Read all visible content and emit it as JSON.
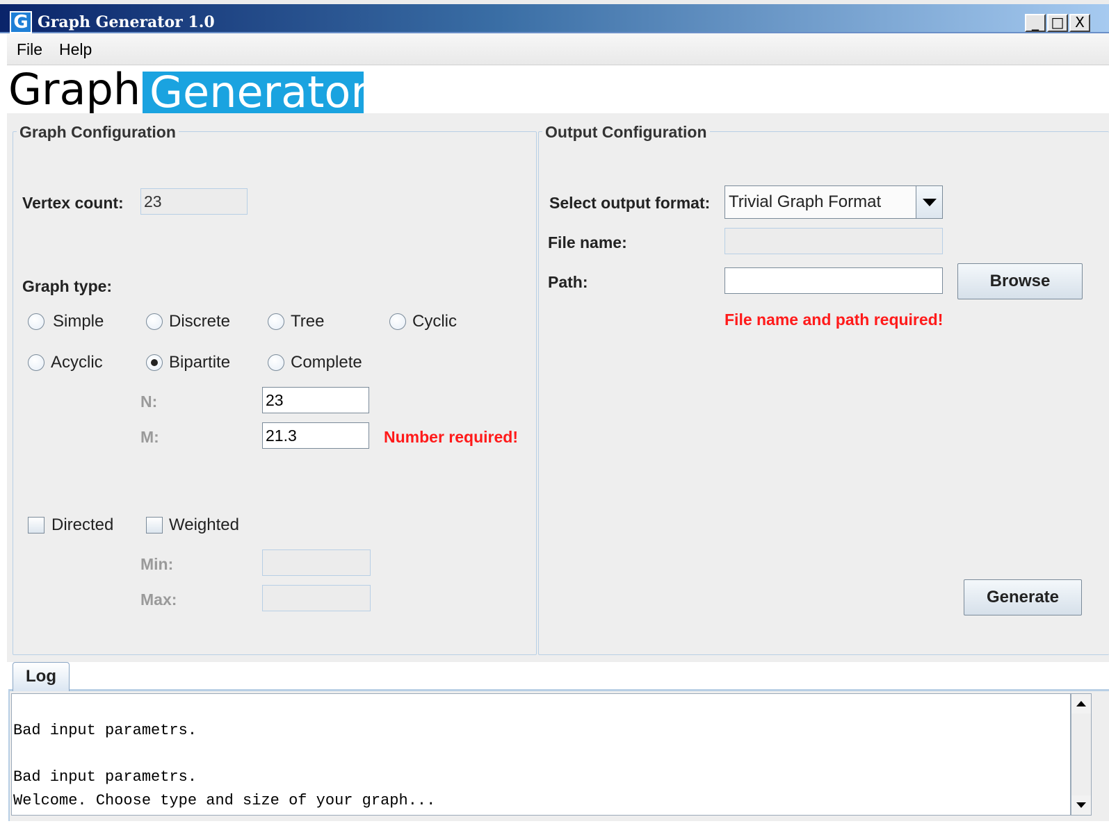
{
  "window": {
    "title": "Graph Generator 1.0",
    "icon_glyph": "G",
    "minimize": "_",
    "maximize": "□",
    "close": "X"
  },
  "menu": {
    "file": "File",
    "help": "Help"
  },
  "banner": {
    "part1": "Graph",
    "part2": "Generator"
  },
  "graph_config": {
    "title": "Graph Configuration",
    "vertex_count_label": "Vertex count:",
    "vertex_count_value": "23",
    "graph_type_label": "Graph type:",
    "types": [
      "Simple",
      "Discrete",
      "Tree",
      "Cyclic",
      "Acyclic",
      "Bipartite",
      "Complete"
    ],
    "selected_type": "Bipartite",
    "n_label": "N:",
    "n_value": "23",
    "m_label": "M:",
    "m_value": "21.3",
    "m_error": "Number required!",
    "directed_label": "Directed",
    "weighted_label": "Weighted",
    "min_label": "Min:",
    "max_label": "Max:",
    "min_value": "",
    "max_value": ""
  },
  "output_config": {
    "title": "Output Configuration",
    "format_label": "Select output format:",
    "format_value": "Trivial Graph Format",
    "file_name_label": "File name:",
    "file_name_value": "",
    "path_label": "Path:",
    "path_value": "",
    "browse_label": "Browse",
    "error": "File name and path required!",
    "generate_label": "Generate"
  },
  "log": {
    "tab_label": "Log",
    "lines": [
      "Bad input parametrs.",
      "Bad input parametrs.",
      "Welcome. Choose type and size of your graph..."
    ]
  },
  "colors": {
    "accent": "#1aa3e0",
    "error": "#ff1a1a",
    "border": "#b8cfe5"
  }
}
